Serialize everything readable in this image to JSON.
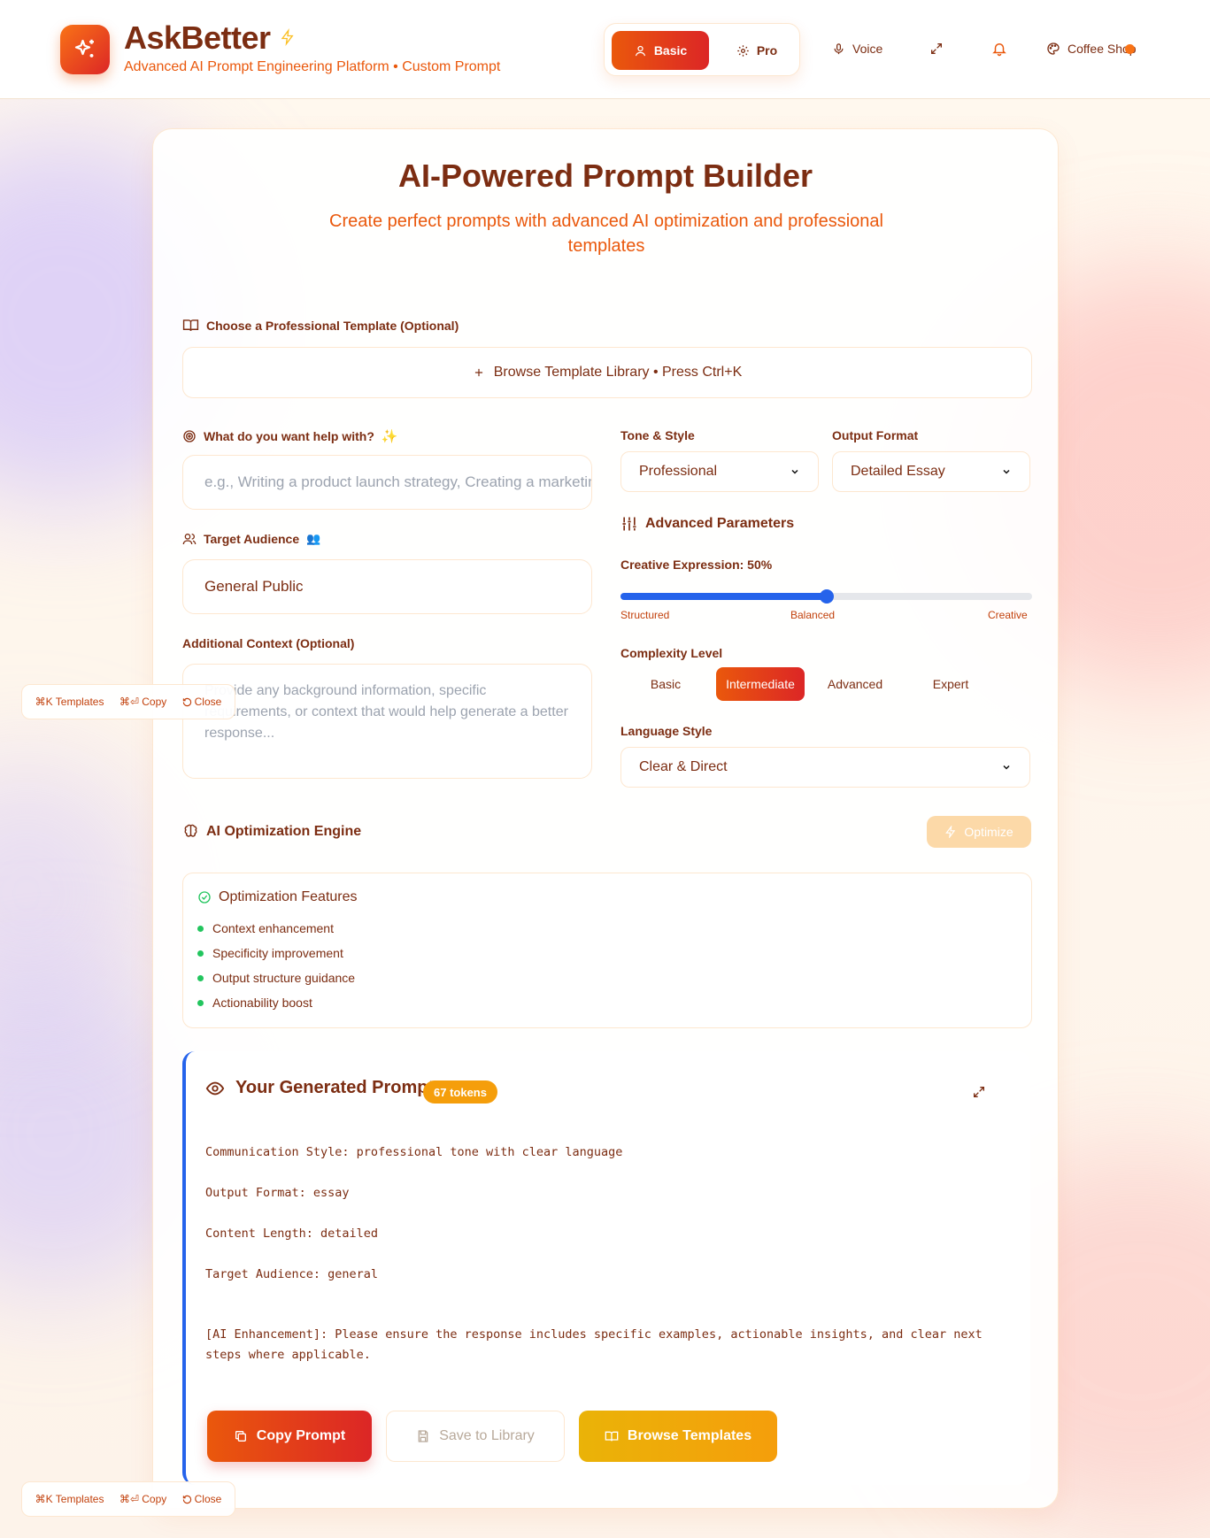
{
  "app": {
    "title": "AskBetter",
    "subtitle": "Advanced AI Prompt Engineering Platform • Custom Prompt"
  },
  "header": {
    "mode_basic": "Basic",
    "mode_pro": "Pro",
    "voice": "Voice",
    "coffee": "Coffee Shop"
  },
  "builder": {
    "title": "AI-Powered Prompt Builder",
    "subtitle": "Create perfect prompts with advanced AI optimization and professional templates",
    "template_label": "Choose a Professional Template (Optional)",
    "browse_library": "Browse Template Library • Press Ctrl+K",
    "help_label": "What do you want help with?",
    "help_placeholder": "e.g., Writing a product launch strategy, Creating a marketing plan",
    "audience_label": "Target Audience",
    "audience_value": "General Public",
    "context_label": "Additional Context (Optional)",
    "context_placeholder": "Provide any background information, specific requirements, or context that would help generate a better response...",
    "tone_label": "Tone & Style",
    "tone_value": "Professional",
    "format_label": "Output Format",
    "format_value": "Detailed Essay",
    "advanced_label": "Advanced Parameters",
    "creative_label": "Creative Expression: 50%",
    "creative_value": 0.5,
    "creative_ticks": [
      "Structured",
      "Balanced",
      "Creative"
    ],
    "complexity_label": "Complexity Level",
    "complexity_options": [
      "Basic",
      "Intermediate",
      "Advanced",
      "Expert"
    ],
    "complexity_selected": "Intermediate",
    "language_label": "Language Style",
    "language_value": "Clear & Direct"
  },
  "optimization": {
    "title": "AI Optimization Engine",
    "button": "Optimize",
    "features_title": "Optimization Features",
    "features": [
      "Context enhancement",
      "Specificity improvement",
      "Output structure guidance",
      "Actionability boost"
    ]
  },
  "generated": {
    "title": "Your Generated Prompt",
    "tokens": "67 tokens",
    "lines": [
      "Communication Style: professional tone with clear language",
      "Output Format: essay",
      "Content Length: detailed",
      "Target Audience: general",
      "[AI Enhancement]: Please ensure the response includes specific examples, actionable insights, and clear next steps where applicable."
    ],
    "copy_button": "Copy Prompt",
    "save_button": "Save to Library",
    "browse_button": "Browse Templates"
  },
  "shortcuts": {
    "templates": "⌘K Templates",
    "copy": "⌘⏎ Copy",
    "close": "Close"
  },
  "colors": {
    "primary": "#ea580c",
    "accent_red": "#dc2626",
    "text_brown": "#7c2d12",
    "gold": "#f59e0b",
    "blue": "#2563eb",
    "green": "#22c55e"
  }
}
